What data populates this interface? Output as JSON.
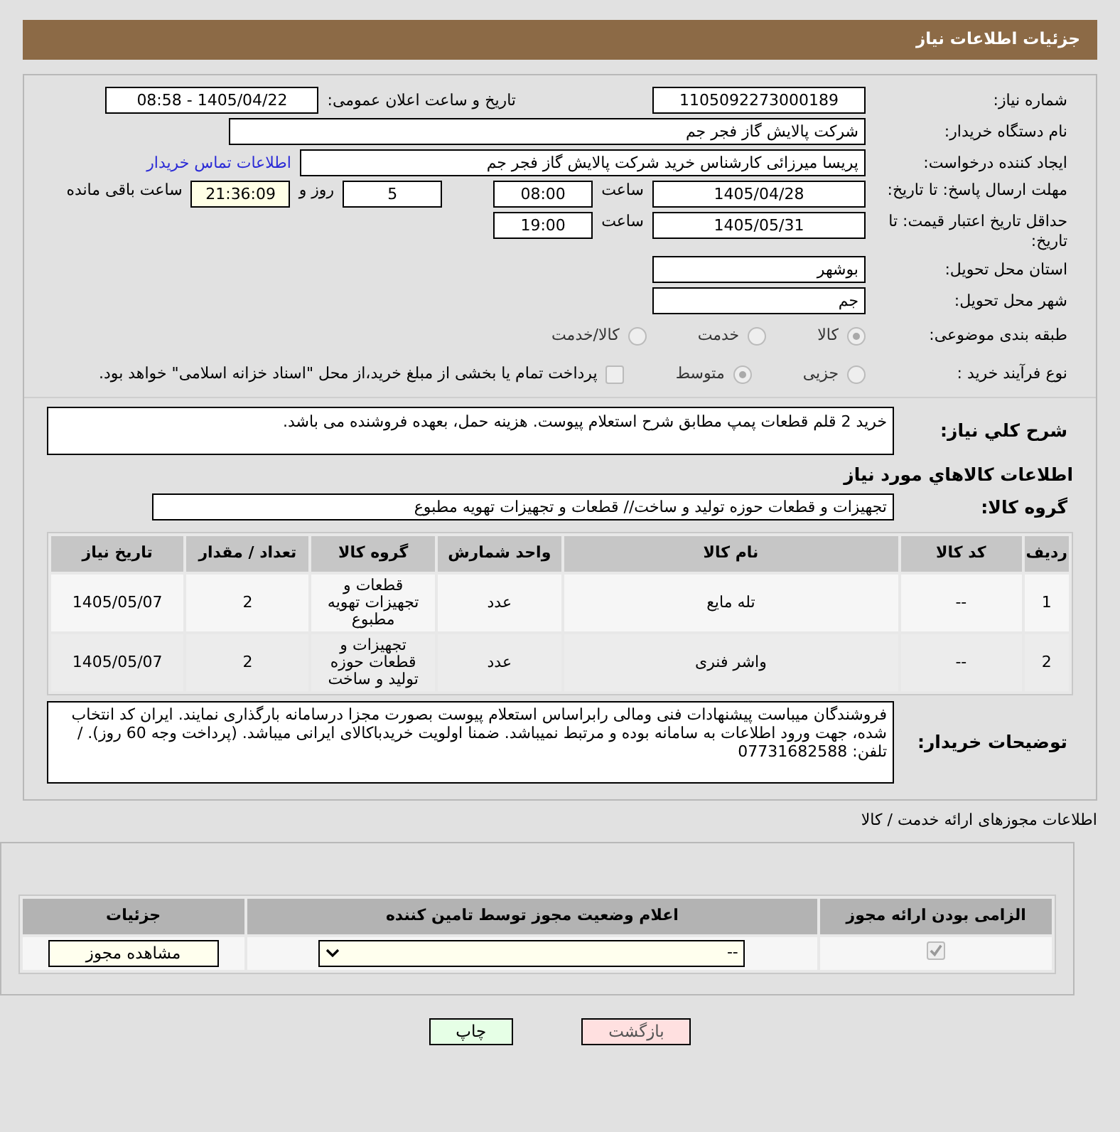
{
  "header": {
    "title": "جزئیات اطلاعات نیاز"
  },
  "need_number": {
    "label": "شماره نیاز:",
    "value": "1105092273000189"
  },
  "announce": {
    "label": "تاریخ و ساعت اعلان عمومی:",
    "value": "1405/04/22 - 08:58"
  },
  "buyer_org": {
    "label": "نام دستگاه خریدار:",
    "value": "شرکت پالایش گاز فجر جم"
  },
  "creator": {
    "label": "ایجاد کننده درخواست:",
    "value": "پریسا میرزائی کارشناس خرید  شرکت پالایش گاز فجر جم",
    "link": "اطلاعات تماس خریدار"
  },
  "deadline": {
    "label": "مهلت ارسال پاسخ: تا تاریخ:",
    "date": "1405/04/28",
    "time_label": "ساعت",
    "time": "08:00",
    "days": "5",
    "days_label": "روز و",
    "remaining": "21:36:09",
    "remaining_label": "ساعت باقی مانده"
  },
  "validity": {
    "label": "حداقل تاریخ اعتبار قیمت: تا تاریخ:",
    "date": "1405/05/31",
    "time_label": "ساعت",
    "time": "19:00"
  },
  "province": {
    "label": "استان محل تحویل:",
    "value": "بوشهر"
  },
  "city": {
    "label": "شهر محل تحویل:",
    "value": "جم"
  },
  "category": {
    "label": "طبقه بندی موضوعی:",
    "options": [
      {
        "label": "کالا",
        "selected": true
      },
      {
        "label": "خدمت",
        "selected": false
      },
      {
        "label": "کالا/خدمت",
        "selected": false
      }
    ]
  },
  "process": {
    "label": "نوع فرآیند خرید :",
    "options": [
      {
        "label": "جزیی",
        "selected": false
      },
      {
        "label": "متوسط",
        "selected": true
      }
    ],
    "payment": {
      "label": "پرداخت تمام یا بخشی از مبلغ خرید،از محل \"اسناد خزانه اسلامی\" خواهد بود.",
      "checked": false
    }
  },
  "description": {
    "label": "شرح کلي نياز:",
    "value": "خرید 2 قلم قطعات پمپ مطابق شرح استعلام پیوست. هزینه حمل، بعهده فروشنده می باشد."
  },
  "goods_title": "اطلاعات کالاهاي مورد نياز",
  "goods_group": {
    "label": "گروه کالا:",
    "value": "تجهیزات و قطعات حوزه تولید و ساخت//  قطعات و تجهیزات تهویه مطبوع"
  },
  "table": {
    "columns": [
      "ردیف",
      "کد کالا",
      "نام کالا",
      "واحد شمارش",
      "گروه کالا",
      "تعداد / مقدار",
      "تاریخ نیاز"
    ],
    "rows": [
      [
        "1",
        "--",
        "تله مایع",
        "عدد",
        "قطعات و تجهیزات تهویه مطبوع",
        "2",
        "1405/05/07"
      ],
      [
        "2",
        "--",
        "واشر فنری",
        "عدد",
        "تجهیزات و قطعات حوزه تولید و ساخت",
        "2",
        "1405/05/07"
      ]
    ]
  },
  "buyer_notes": {
    "label": "توضیحات خریدار:",
    "value": "فروشندگان میباست پیشنهادات فنی ومالی رابراساس استعلام پیوست بصورت مجزا درسامانه بارگذاری نمایند. ایران کد انتخاب شده، جهت ورود اطلاعات به سامانه بوده و مرتبط نمیباشد. ضمنا اولویت خریدباکالای ایرانی میباشد. (پرداخت وجه 60 روز). / تلفن: 07731682588"
  },
  "permits": {
    "title": "اطلاعات مجوزهای ارائه خدمت / کالا",
    "columns": [
      "الزامی بودن ارائه مجوز",
      "اعلام وضعیت مجوز توسط تامین کننده",
      "جزئیات"
    ],
    "rows": [
      {
        "required": true,
        "status": "--",
        "button": "مشاهده مجوز"
      }
    ]
  },
  "buttons": [
    {
      "kind": "back",
      "label": "بازگشت"
    },
    {
      "kind": "print",
      "label": "چاپ"
    }
  ]
}
